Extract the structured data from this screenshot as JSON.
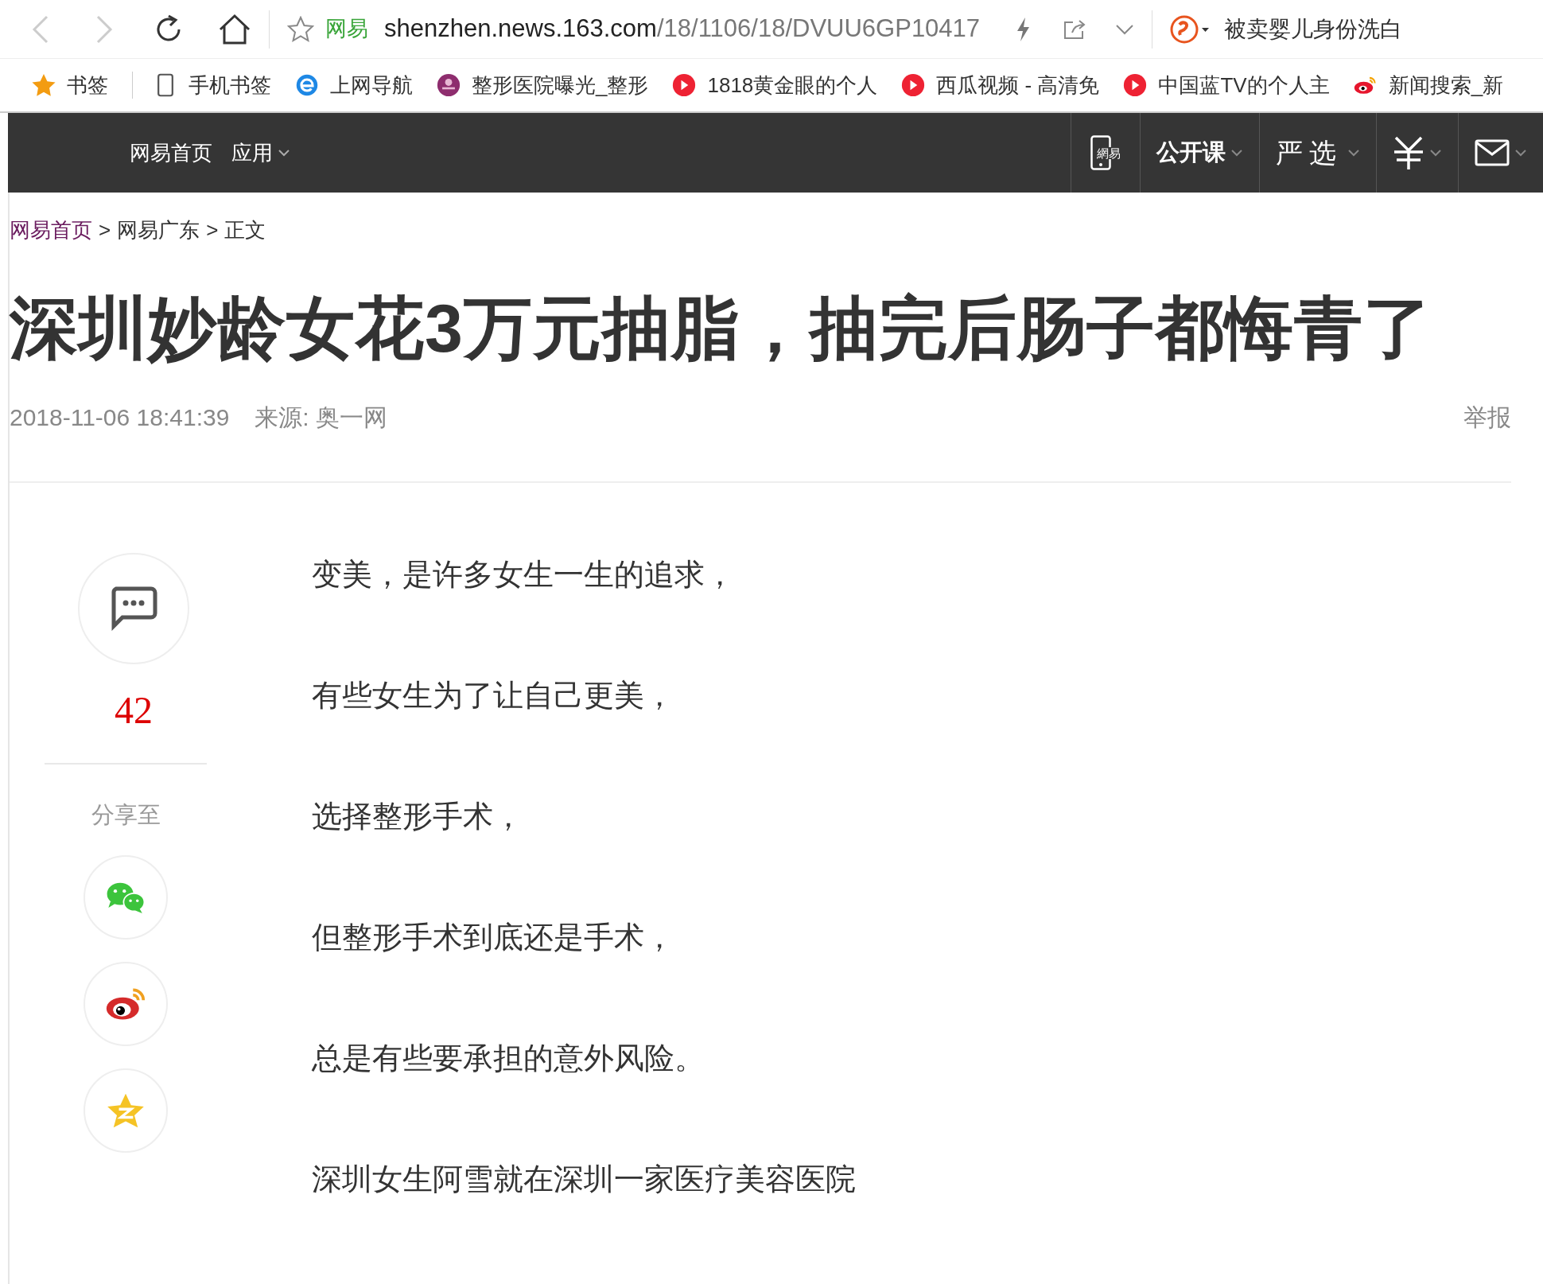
{
  "browser": {
    "back_disabled": true,
    "forward_disabled": true,
    "site_label": "网易",
    "url_host": "shenzhen.news.163.com",
    "url_path": "/18/1106/18/DVUU6GP10417",
    "search_text": "被卖婴儿身份洗白"
  },
  "bookmarks": [
    {
      "kind": "star",
      "label": "书签"
    },
    {
      "kind": "phone",
      "label": "手机书签"
    },
    {
      "kind": "ie",
      "label": "上网导航"
    },
    {
      "kind": "flower",
      "label": "整形医院曝光_整形"
    },
    {
      "kind": "play",
      "label": "1818黄金眼的个人"
    },
    {
      "kind": "play",
      "label": "西瓜视频 - 高清免"
    },
    {
      "kind": "play",
      "label": "中国蓝TV的个人主"
    },
    {
      "kind": "weibo",
      "label": "新闻搜索_新"
    }
  ],
  "site_nav": {
    "left": [
      {
        "label": "网易首页",
        "dropdown": false
      },
      {
        "label": "应用",
        "dropdown": true
      }
    ],
    "right": [
      {
        "kind": "phone-logo",
        "label": "網易",
        "dropdown": false
      },
      {
        "kind": "text",
        "label": "公开课",
        "dropdown": true
      },
      {
        "kind": "script",
        "label": "严选",
        "dropdown": true
      },
      {
        "kind": "yen",
        "dropdown": true
      },
      {
        "kind": "mail",
        "dropdown": true
      }
    ]
  },
  "breadcrumb": {
    "separator": ">",
    "items": [
      {
        "label": "网易首页",
        "link": true
      },
      {
        "label": "网易广东",
        "link": false
      },
      {
        "label": "正文",
        "link": false
      }
    ]
  },
  "article": {
    "title": "深圳妙龄女花3万元抽脂，抽完后肠子都悔青了",
    "date": "2018-11-06 18:41:39",
    "source": "来源: 奥一网",
    "report": "举报",
    "paragraphs": [
      "变美，是许多女生一生的追求，",
      "有些女生为了让自己更美，",
      "选择整形手术，",
      "但整形手术到底还是手术，",
      "总是有些要承担的意外风险。",
      "深圳女生阿雪就在深圳一家医疗美容医院"
    ]
  },
  "sidebar": {
    "comment_count": "42",
    "share_label": "分享至",
    "share": [
      {
        "kind": "wechat"
      },
      {
        "kind": "weibo"
      },
      {
        "kind": "qzone"
      }
    ]
  }
}
